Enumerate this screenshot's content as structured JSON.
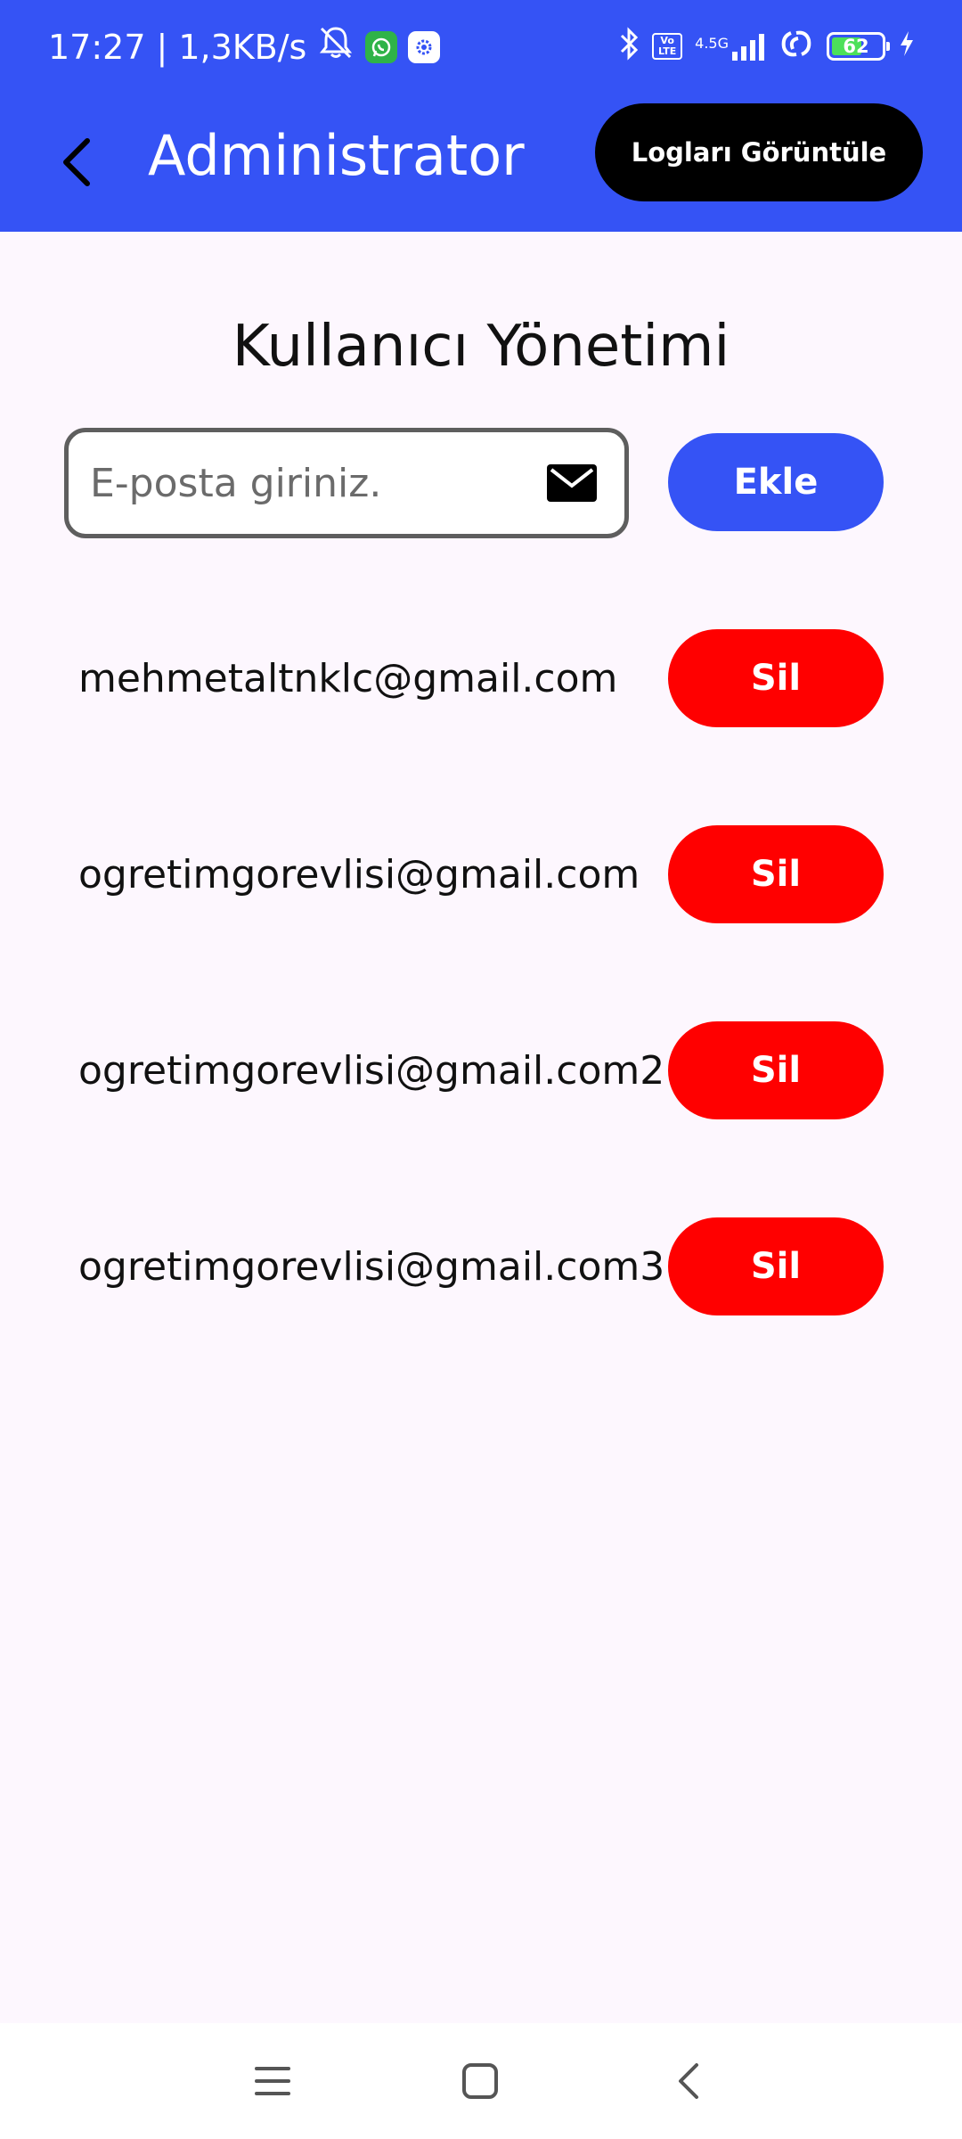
{
  "status_bar": {
    "time": "17:27",
    "network_speed": "1,3KB/s",
    "network_type": "4.5G",
    "volte_label": "Vo LTE",
    "battery_level": "62",
    "icons": [
      "mute-icon",
      "whatsapp-icon",
      "settings-app-icon",
      "bluetooth-icon",
      "volte-icon",
      "signal-icon",
      "hotspot-icon",
      "battery-icon",
      "charging-icon"
    ]
  },
  "appbar": {
    "title": "Administrator",
    "logs_button_label": "Logları Görüntüle"
  },
  "page": {
    "title": "Kullanıcı Yönetimi"
  },
  "add_user": {
    "placeholder": "E-posta giriniz.",
    "value": "",
    "button_label": "Ekle"
  },
  "users": [
    {
      "email": "mehmetaltnklc@gmail.com",
      "delete_label": "Sil"
    },
    {
      "email": "ogretimgorevlisi@gmail.com",
      "delete_label": "Sil"
    },
    {
      "email": "ogretimgorevlisi@gmail.com2",
      "delete_label": "Sil"
    },
    {
      "email": "ogretimgorevlisi@gmail.com3",
      "delete_label": "Sil"
    }
  ],
  "colors": {
    "primary": "#3553F5",
    "danger": "#FF0000",
    "background": "#FDF7FE",
    "logs_button": "#000000"
  }
}
